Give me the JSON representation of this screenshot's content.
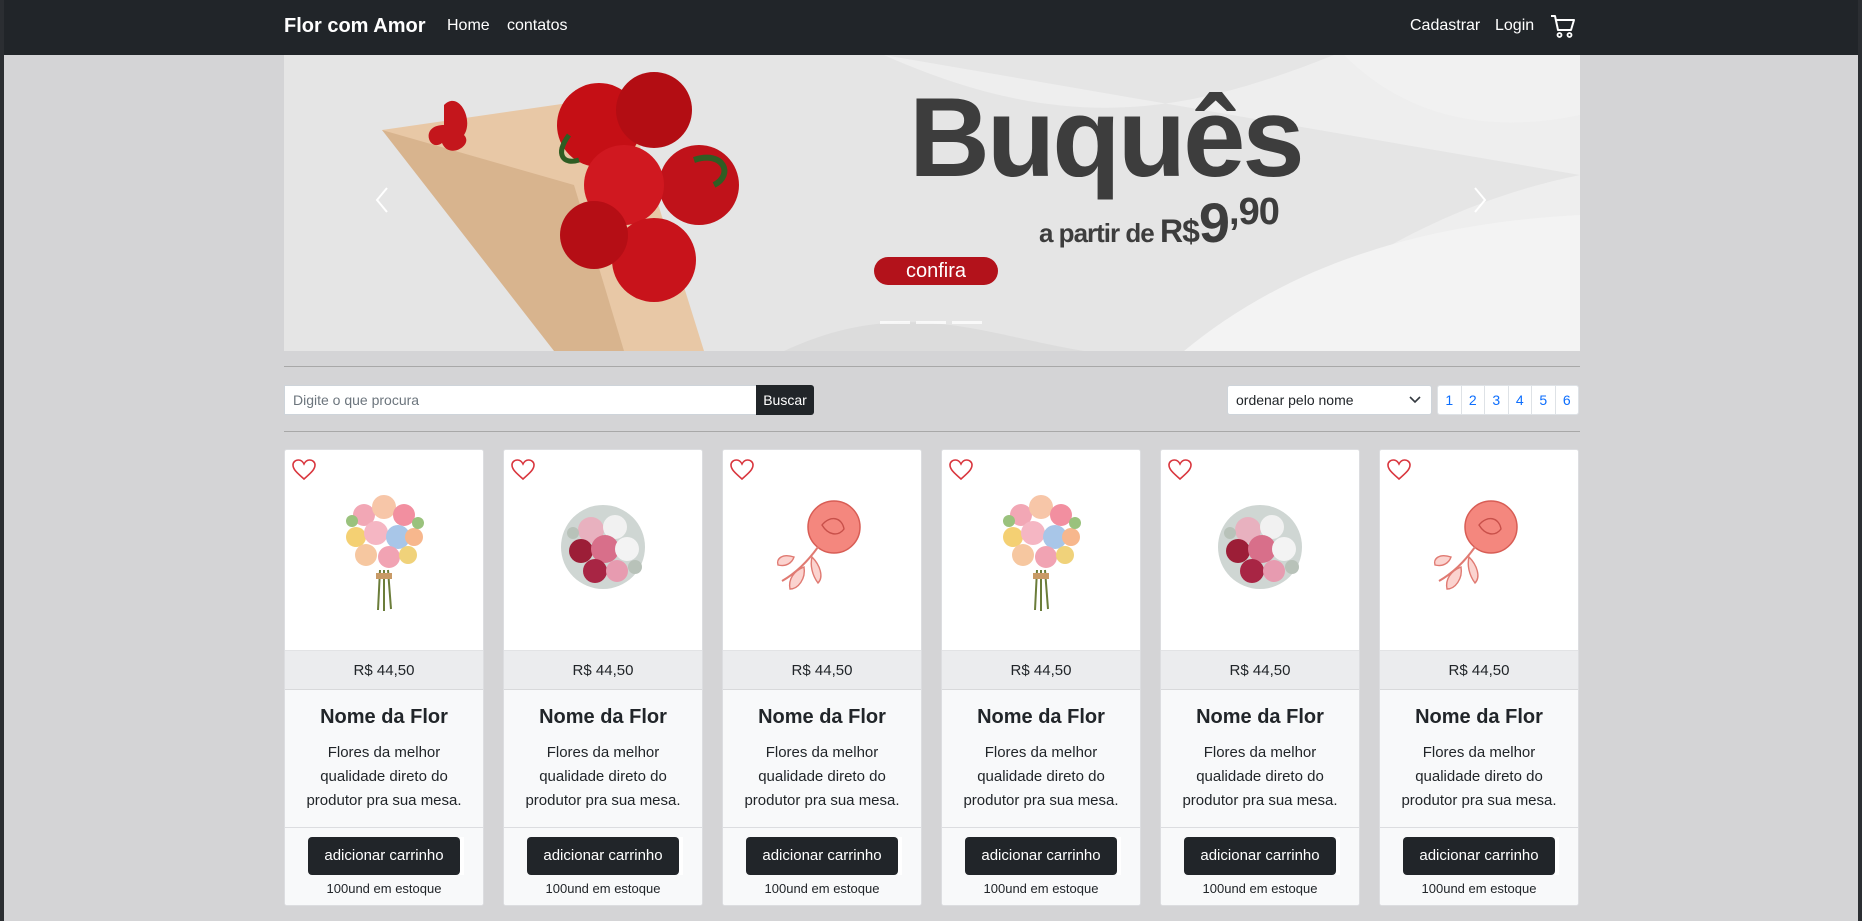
{
  "navbar": {
    "brand": "Flor com Amor",
    "links": [
      "Home",
      "contatos"
    ],
    "right_links": [
      "Cadastrar",
      "Login"
    ],
    "cart_icon": "cart-icon"
  },
  "banner": {
    "title": "Buquês",
    "subtitle_prefix": "a partir de",
    "currency": "R$",
    "price_whole": "9",
    "price_cents": ",90",
    "cta": "confira",
    "accent_color": "#b3121b"
  },
  "search": {
    "placeholder": "Digite o que procura",
    "button_label": "Buscar"
  },
  "sort": {
    "selected": "ordenar pelo nome"
  },
  "pagination": [
    "1",
    "2",
    "3",
    "4",
    "5",
    "6"
  ],
  "products": [
    {
      "price": "R$ 44,50",
      "name": "Nome da Flor",
      "description": "Flores da melhor qualidade direto do produtor pra sua mesa.",
      "button": "adicionar carrinho",
      "stock": "100und em estoque",
      "image": "mixed-bouquet"
    },
    {
      "price": "R$ 44,50",
      "name": "Nome da Flor",
      "description": "Flores da melhor qualidade direto do produtor pra sua mesa.",
      "button": "adicionar carrinho",
      "stock": "100und em estoque",
      "image": "round-bouquet"
    },
    {
      "price": "R$ 44,50",
      "name": "Nome da Flor",
      "description": "Flores da melhor qualidade direto do produtor pra sua mesa.",
      "button": "adicionar carrinho",
      "stock": "100und em estoque",
      "image": "single-rose"
    },
    {
      "price": "R$ 44,50",
      "name": "Nome da Flor",
      "description": "Flores da melhor qualidade direto do produtor pra sua mesa.",
      "button": "adicionar carrinho",
      "stock": "100und em estoque",
      "image": "mixed-bouquet"
    },
    {
      "price": "R$ 44,50",
      "name": "Nome da Flor",
      "description": "Flores da melhor qualidade direto do produtor pra sua mesa.",
      "button": "adicionar carrinho",
      "stock": "100und em estoque",
      "image": "round-bouquet"
    },
    {
      "price": "R$ 44,50",
      "name": "Nome da Flor",
      "description": "Flores da melhor qualidade direto do produtor pra sua mesa.",
      "button": "adicionar carrinho",
      "stock": "100und em estoque",
      "image": "single-rose"
    }
  ]
}
